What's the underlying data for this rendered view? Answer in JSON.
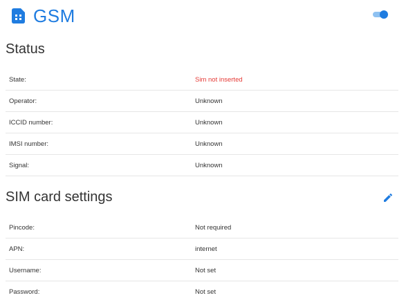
{
  "header": {
    "title": "GSM",
    "icon": "sim-card-icon",
    "accent_color": "#1f7ce0",
    "toggle_enabled": true
  },
  "status": {
    "title": "Status",
    "rows": [
      {
        "label": "State:",
        "value": "Sim not inserted"
      },
      {
        "label": "Operator:",
        "value": "Unknown"
      },
      {
        "label": "ICCID number:",
        "value": "Unknown"
      },
      {
        "label": "IMSI number:",
        "value": "Unknown"
      },
      {
        "label": "Signal:",
        "value": "Unknown"
      }
    ],
    "error_color": "#e53935"
  },
  "sim_settings": {
    "title": "SIM card settings",
    "edit_icon": "pencil-icon",
    "rows": [
      {
        "label": "Pincode:",
        "value": "Not required"
      },
      {
        "label": "APN:",
        "value": "internet"
      },
      {
        "label": "Username:",
        "value": "Not set"
      },
      {
        "label": "Password:",
        "value": "Not set"
      }
    ]
  }
}
